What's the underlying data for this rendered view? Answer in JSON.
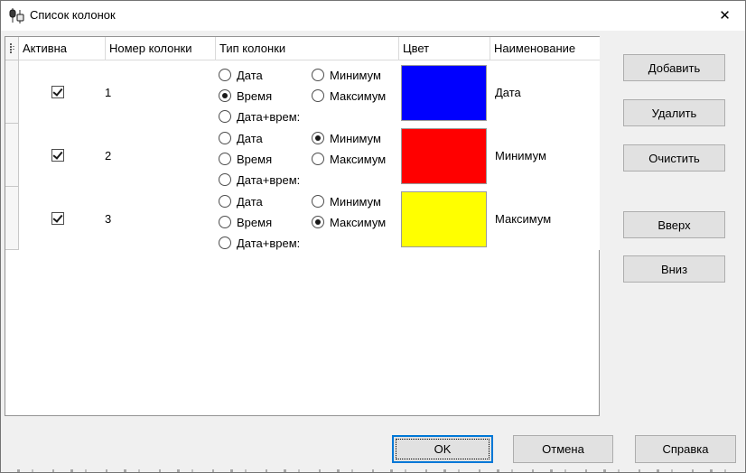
{
  "window": {
    "title": "Список колонок",
    "close_glyph": "✕"
  },
  "grid": {
    "headers": {
      "active": "Активна",
      "number": "Номер колонки",
      "type": "Тип колонки",
      "color": "Цвет",
      "name": "Наименование"
    },
    "type_options": {
      "date": "Дата",
      "time": "Время",
      "datetime": "Дата+врем:",
      "min": "Минимум",
      "max": "Максимум"
    },
    "rows": [
      {
        "active": "true",
        "number": "1",
        "type": {
          "date": "false",
          "time": "true",
          "datetime": "false",
          "min": "false",
          "max": "false"
        },
        "color": "#0000ff",
        "name": "Дата"
      },
      {
        "active": "true",
        "number": "2",
        "type": {
          "date": "false",
          "time": "false",
          "datetime": "false",
          "min": "true",
          "max": "false"
        },
        "color": "#ff0000",
        "name": "Минимум"
      },
      {
        "active": "true",
        "number": "3",
        "type": {
          "date": "false",
          "time": "false",
          "datetime": "false",
          "min": "false",
          "max": "true"
        },
        "color": "#ffff00",
        "name": "Максимум"
      }
    ]
  },
  "side_buttons": {
    "add": "Добавить",
    "remove": "Удалить",
    "clear": "Очистить",
    "up": "Вверх",
    "down": "Вниз"
  },
  "bottom_buttons": {
    "ok": "OK",
    "cancel": "Отмена",
    "help": "Справка"
  },
  "colors": {
    "accent": "#0078d7"
  }
}
